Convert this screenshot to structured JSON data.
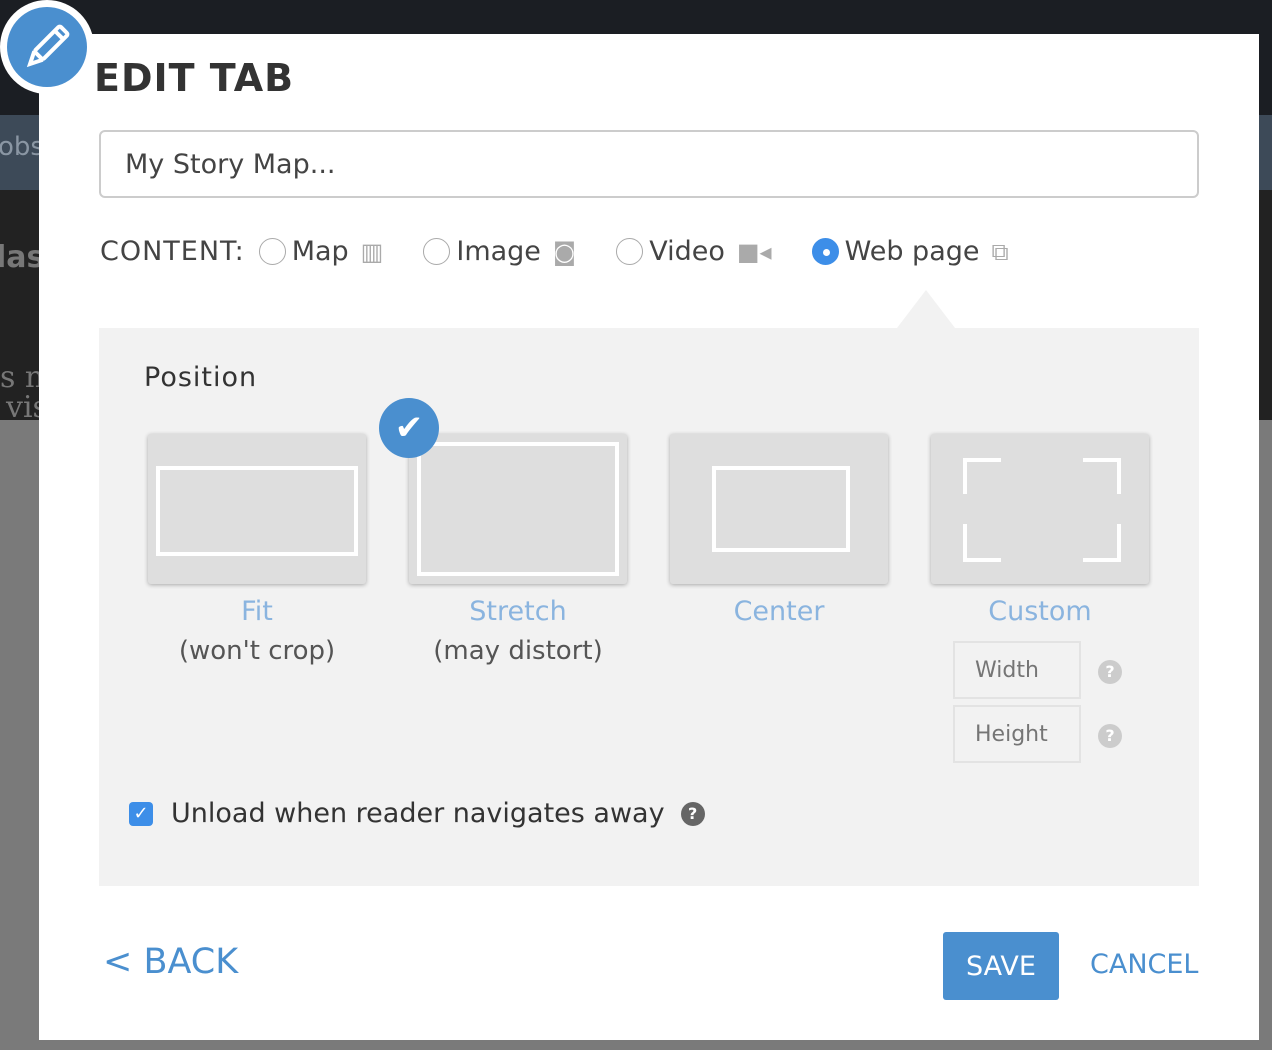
{
  "background": {
    "text_1": "obs",
    "text_2": "las",
    "text_3": "s n",
    "text_4": "vis"
  },
  "modal": {
    "title": "EDIT TAB",
    "title_input_value": "My Story Map...",
    "content_label": "CONTENT:",
    "content_options": [
      {
        "label": "Map",
        "icon": "map-icon",
        "selected": false
      },
      {
        "label": "Image",
        "icon": "camera-icon",
        "selected": false
      },
      {
        "label": "Video",
        "icon": "video-camera-icon",
        "selected": false
      },
      {
        "label": "Web page",
        "icon": "external-link-icon",
        "selected": true
      }
    ],
    "position": {
      "title": "Position",
      "options": [
        {
          "label": "Fit",
          "sub": "(won't crop)",
          "selected": false
        },
        {
          "label": "Stretch",
          "sub": "(may distort)",
          "selected": true
        },
        {
          "label": "Center",
          "sub": "",
          "selected": false
        },
        {
          "label": "Custom",
          "sub": "",
          "selected": false
        }
      ],
      "width_placeholder": "Width",
      "height_placeholder": "Height",
      "help_glyph": "?"
    },
    "unload_label": "Unload when reader navigates away",
    "unload_checked": true,
    "back_label": "< BACK",
    "save_label": "SAVE",
    "cancel_label": "CANCEL"
  },
  "colors": {
    "accent": "#4a8fcf",
    "radio_selected": "#3d8ee8",
    "panel": "#f2f2f2"
  }
}
